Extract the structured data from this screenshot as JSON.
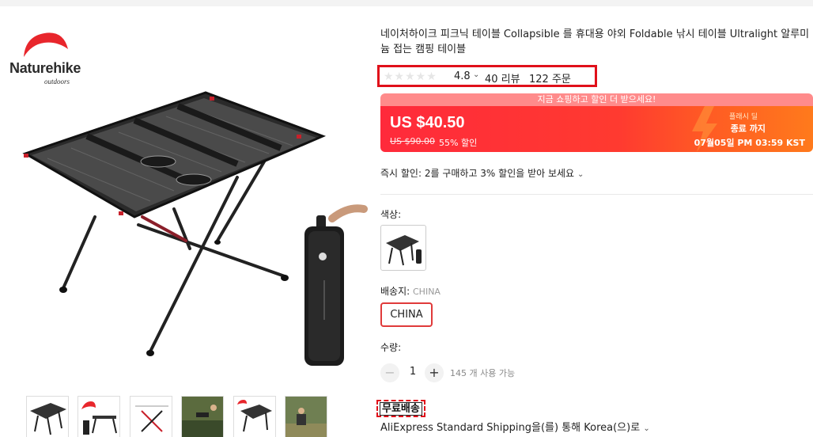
{
  "brand": {
    "name": "Naturehike",
    "subtitle": "outdoors"
  },
  "product": {
    "title": "네이처하이크 피크닉 테이블 Collapsible 를 휴대용 야외 Foldable 낚시 테이블 Ultralight 알루미늄 접는 캠핑 테이블"
  },
  "rating": {
    "value": "4.8",
    "stars": 5,
    "reviews": "40 리뷰",
    "orders": "122 주문"
  },
  "promo": {
    "banner": "지금 쇼핑하고 할인 더 받으세요!"
  },
  "price": {
    "current": "US $40.50",
    "original": "US $90.00",
    "discount": "55% 할인"
  },
  "flash_deal": {
    "label": "플래시 딜",
    "ends": "종료 까지",
    "end_time": "07월05일 PM 03:59 KST"
  },
  "instant_discount": "즉시 할인: 2를 구매하고 3% 할인을 받아 보세요",
  "color": {
    "label": "색상:"
  },
  "ships_from": {
    "label": "배송지:",
    "value": "CHINA",
    "option": "CHINA"
  },
  "quantity": {
    "label": "수량:",
    "minus": "−",
    "value": "1",
    "plus": "+",
    "available": "145 개 사용 가능"
  },
  "shipping": {
    "free": "무료배송",
    "method": "AliExpress Standard Shipping을(를) 통해 Korea(으)로"
  },
  "colors": {
    "accent": "#ff2a3b",
    "highlight_box": "#e0101a",
    "brand_red": "#e8262c"
  }
}
